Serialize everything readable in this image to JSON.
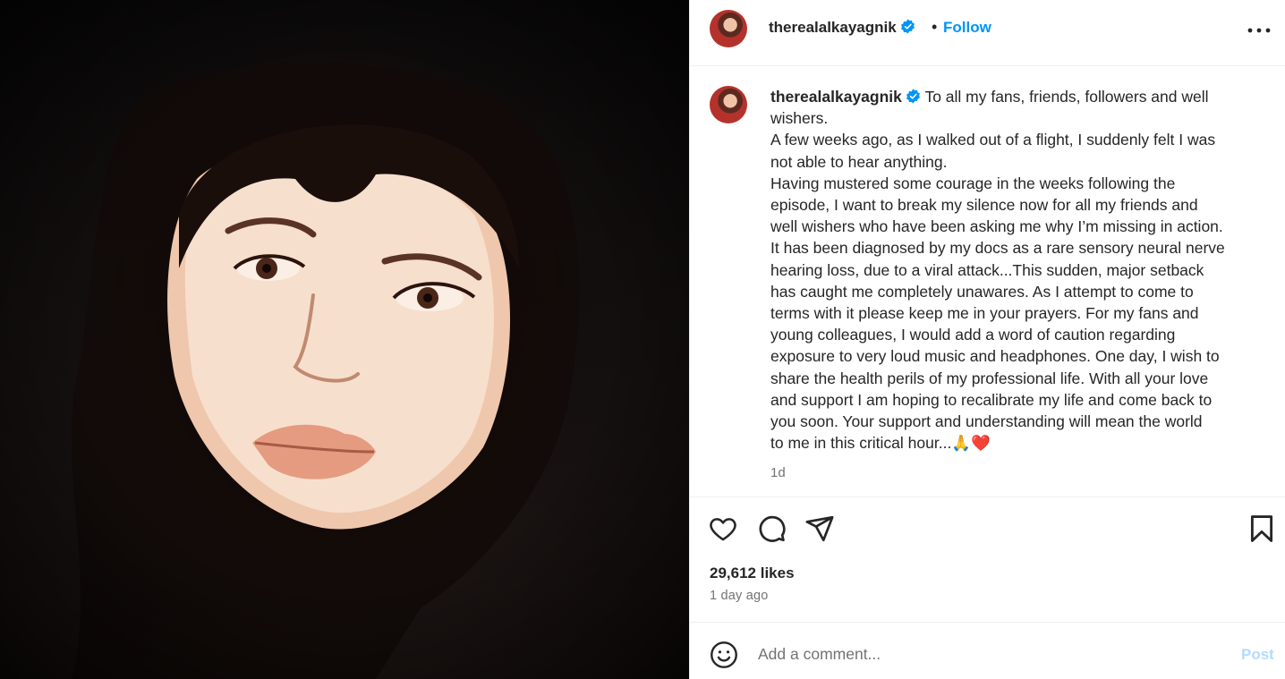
{
  "post": {
    "username": "therealalkayagnik",
    "verified_icon": "verified-badge-icon",
    "follow_label": "Follow",
    "separator": "•",
    "caption_lines": [
      "To all my fans, friends, followers and well",
      "wishers.",
      "A few weeks ago, as I walked out of a flight, I suddenly felt I was",
      "not able to hear anything.",
      "Having mustered some courage in the weeks following the",
      "episode, I want to break my silence now for all my friends and",
      "well wishers who have been asking me why I’m missing in action.",
      "It has been diagnosed by my docs as a rare sensory neural nerve",
      "hearing loss, due to a viral attack...This sudden, major setback",
      "has caught me completely unawares. As I attempt to come to",
      "terms with it please keep me in your prayers. For my fans and",
      "young colleagues, I would add a word of caution regarding",
      "exposure to very loud music and headphones. One day, I wish to",
      "share the health perils of my professional life. With all your love",
      "and support I am hoping to recalibrate my life and come back to",
      "you soon. Your support and understanding will mean the world",
      "to me in this critical hour...🙏❤️"
    ],
    "caption_age": "1d",
    "likes": "29,612 likes",
    "date": "1 day ago",
    "comment_placeholder": "Add a comment...",
    "post_label": "Post"
  },
  "icons": {
    "more": "more-options-icon",
    "like": "heart-icon",
    "comment": "comment-icon",
    "share": "share-icon",
    "save": "bookmark-icon",
    "emoji": "emoji-icon"
  },
  "colors": {
    "accent": "#0095f6",
    "post_disabled": "#b3dbff",
    "verified": "#0095f6",
    "secondary_text": "#737373"
  }
}
